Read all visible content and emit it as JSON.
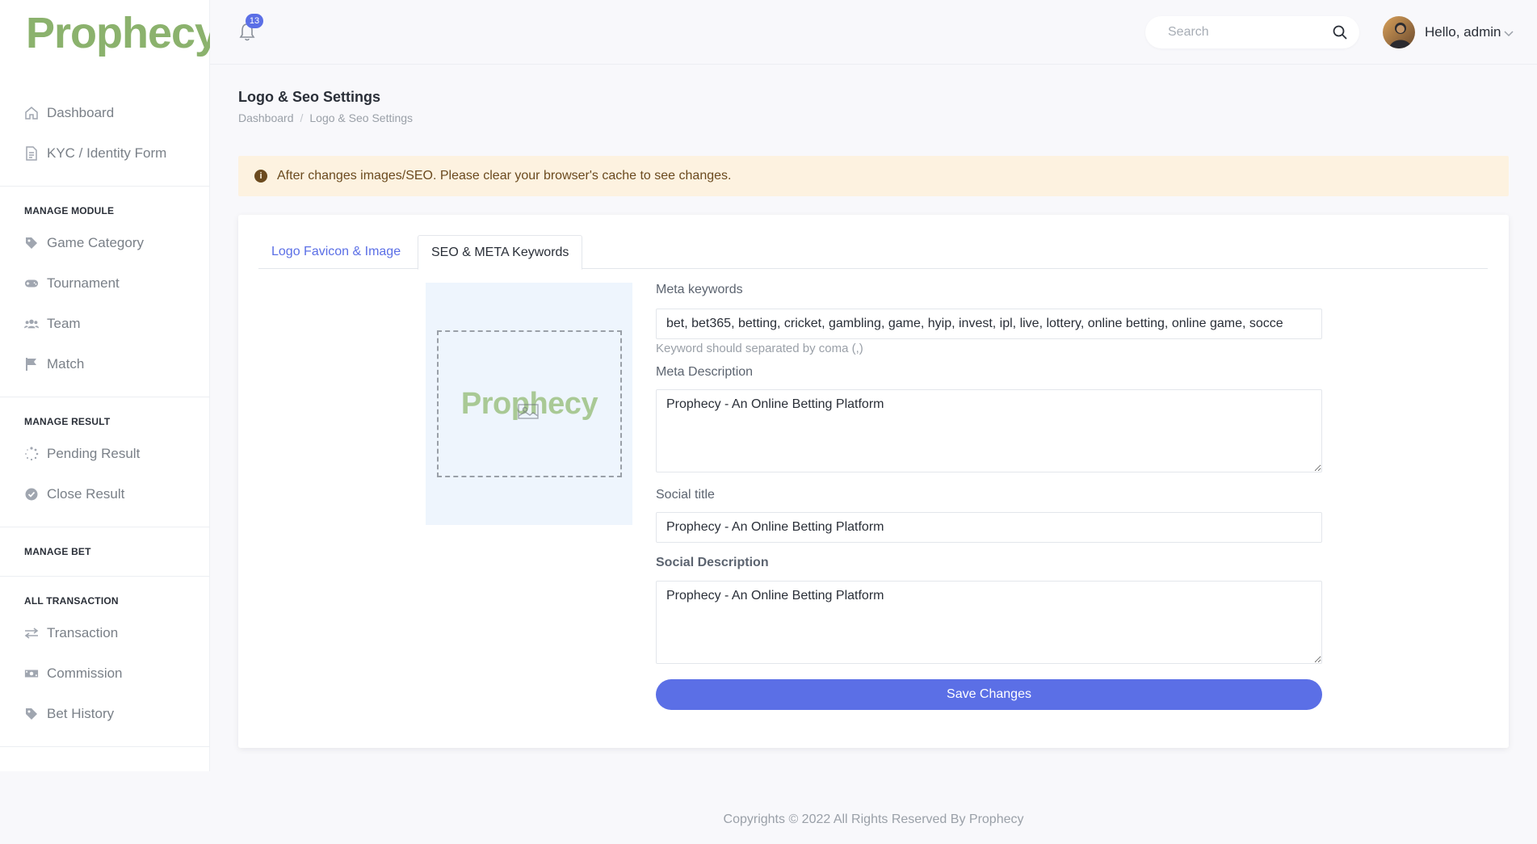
{
  "brand": "Prophecy",
  "notifications": {
    "count": "13"
  },
  "search": {
    "placeholder": "Search"
  },
  "user": {
    "greeting": "Hello, admin"
  },
  "sidebar": {
    "items_top": [
      {
        "label": "Dashboard",
        "icon": "home-icon"
      },
      {
        "label": "KYC / Identity Form",
        "icon": "document-icon"
      }
    ],
    "sections": [
      {
        "title": "MANAGE MODULE",
        "items": [
          {
            "label": "Game Category",
            "icon": "tag-icon"
          },
          {
            "label": "Tournament",
            "icon": "gamepad-icon"
          },
          {
            "label": "Team",
            "icon": "users-icon"
          },
          {
            "label": "Match",
            "icon": "flag-icon"
          }
        ]
      },
      {
        "title": "MANAGE RESULT",
        "items": [
          {
            "label": "Pending Result",
            "icon": "spinner-icon"
          },
          {
            "label": "Close Result",
            "icon": "check-circle-icon"
          }
        ]
      },
      {
        "title": "MANAGE BET",
        "items": []
      },
      {
        "title": "ALL TRANSACTION",
        "items": [
          {
            "label": "Transaction",
            "icon": "exchange-icon"
          },
          {
            "label": "Commission",
            "icon": "money-icon"
          },
          {
            "label": "Bet History",
            "icon": "tag-icon"
          }
        ]
      }
    ]
  },
  "page": {
    "title": "Logo & Seo Settings",
    "breadcrumb": [
      "Dashboard",
      "Logo & Seo Settings"
    ]
  },
  "alert": {
    "text": "After changes images/SEO. Please clear your browser's cache to see changes."
  },
  "tabs": [
    {
      "label": "Logo Favicon & Image",
      "active": false
    },
    {
      "label": "SEO & META Keywords",
      "active": true
    }
  ],
  "preview": {
    "logo_text": "Prophecy"
  },
  "form": {
    "meta_keywords_label": "Meta keywords",
    "meta_keywords_value": "bet, bet365, betting, cricket, gambling, game, hyip, invest, ipl, live, lottery, online betting, online game, socce",
    "meta_keywords_help": "Keyword should separated by coma (,)",
    "meta_description_label": "Meta Description",
    "meta_description_value": "Prophecy - An Online Betting Platform",
    "social_title_label": "Social title",
    "social_title_value": "Prophecy - An Online Betting Platform",
    "social_description_label": "Social Description",
    "social_description_value": "Prophecy - An Online Betting Platform",
    "save_label": "Save Changes"
  },
  "footer": {
    "text": "Copyrights © 2022 All Rights Reserved By Prophecy"
  },
  "colors": {
    "brand": "#8bb26d",
    "accent": "#5b6fe6",
    "alert_bg": "#fdf2e0"
  }
}
